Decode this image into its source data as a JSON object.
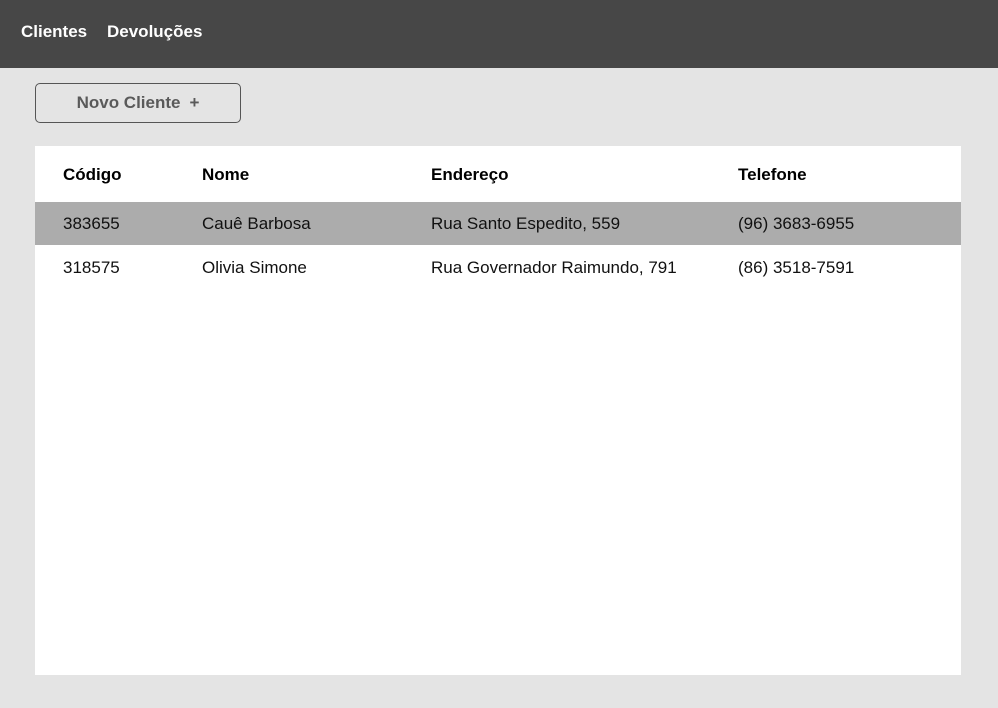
{
  "nav": {
    "items": [
      {
        "label": "Clientes"
      },
      {
        "label": "Devoluções"
      }
    ]
  },
  "toolbar": {
    "new_client_label": "Novo Cliente",
    "new_client_icon": "+"
  },
  "table": {
    "columns": [
      "Código",
      "Nome",
      "Endereço",
      "Telefone"
    ],
    "rows": [
      [
        "383655",
        "Cauê Barbosa",
        "Rua Santo Espedito, 559",
        "(96) 3683-6955"
      ],
      [
        "318575",
        "Olivia Simone",
        "Rua Governador Raimundo, 791",
        "(86) 3518-7591"
      ]
    ],
    "selected_row_index": 0
  },
  "colors": {
    "topbar": "#474747",
    "background": "#e4e4e4",
    "panel": "#ffffff",
    "selected_row": "#acacac"
  }
}
